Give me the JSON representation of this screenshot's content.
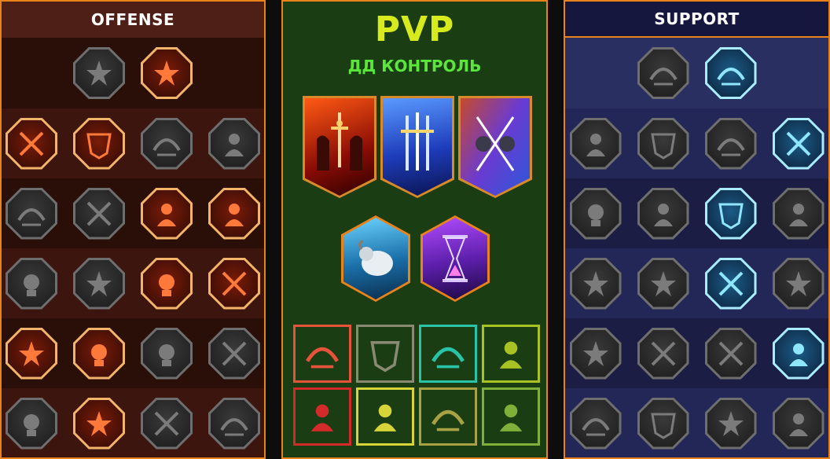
{
  "offense": {
    "title": "OFFENSE",
    "rows": [
      [
        "swords-icon",
        "claw-strike-icon"
      ],
      [
        "demon-icon",
        "slash-icon",
        "shield-break-icon",
        "heart-icon"
      ],
      [
        "archer-icon",
        "maw-icon",
        "skull-fire-icon",
        "scythe-icon"
      ],
      [
        "impale-icon",
        "fist-icon",
        "axe-icon",
        "chain-icon"
      ],
      [
        "burst-icon",
        "skulls-icon",
        "blade-icon",
        "giant-icon"
      ],
      [
        "sword-sparkle-icon",
        "helmet-fire-icon",
        "beast-icon",
        "skull-knight-icon"
      ]
    ],
    "states": [
      [
        "off",
        "red"
      ],
      [
        "red",
        "red",
        "off",
        "off"
      ],
      [
        "off",
        "off",
        "red",
        "red"
      ],
      [
        "off",
        "off",
        "red",
        "red"
      ],
      [
        "red",
        "red",
        "off",
        "off"
      ],
      [
        "off",
        "red",
        "off",
        "off"
      ]
    ]
  },
  "pvp": {
    "title": "PVP",
    "subtitle": "ДД КОНТРОЛЬ",
    "banners": [
      "red-knights-banner",
      "blue-swords-banner",
      "crossed-swords-banner"
    ],
    "relics": [
      "ram-relic",
      "hourglass-relic"
    ],
    "sets": [
      {
        "icon": "wolf-set-icon",
        "color": "#e4533a"
      },
      {
        "icon": "star-set-icon",
        "color": "#8a8a72"
      },
      {
        "icon": "shield-cross-set-icon",
        "color": "#29c4a8"
      },
      {
        "icon": "serpent-set-icon",
        "color": "#a8c224"
      },
      {
        "icon": "claw-set-icon",
        "color": "#d32a2a"
      },
      {
        "icon": "monk-set-icon",
        "color": "#d7d43a"
      },
      {
        "icon": "crown-star-set-icon",
        "color": "#a8a244"
      },
      {
        "icon": "shield-arrow-set-icon",
        "color": "#7fb03a"
      }
    ]
  },
  "support": {
    "title": "SUPPORT",
    "rows": [
      [
        "heart-plus-icon",
        "shield-swirl-icon"
      ],
      [
        "pray-icon",
        "aura-icon",
        "skull-flame-icon",
        "arrow-hit-icon"
      ],
      [
        "aura-man-icon",
        "lightning-icon",
        "shatter-icon",
        "shadow-icon"
      ],
      [
        "chain-heart-icon",
        "comet-icon",
        "book-icon",
        "eyes-icon"
      ],
      [
        "compass-icon",
        "boots-icon",
        "eye-icon",
        "voodoo-icon"
      ],
      [
        "potion-icon",
        "skull-wing-icon",
        "fist-crown-icon",
        "eagle-icon"
      ]
    ],
    "states": [
      [
        "off",
        "blue"
      ],
      [
        "off",
        "off",
        "off",
        "blue"
      ],
      [
        "off",
        "off",
        "blue",
        "off"
      ],
      [
        "off",
        "off",
        "blue",
        "off"
      ],
      [
        "off",
        "off",
        "off",
        "blue"
      ],
      [
        "off",
        "off",
        "off",
        "off"
      ]
    ]
  }
}
